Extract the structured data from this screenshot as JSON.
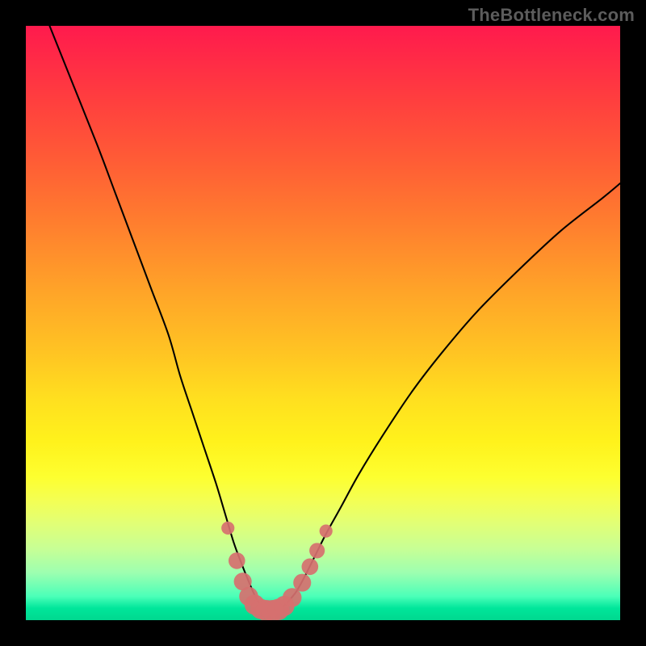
{
  "watermark": "TheBottleneck.com",
  "colors": {
    "frame": "#000000",
    "curve_stroke": "#000000",
    "marker_fill": "#d6706f",
    "gradient_top": "#ff1a4d",
    "gradient_bottom": "#00d88f"
  },
  "chart_data": {
    "type": "line",
    "title": "",
    "xlabel": "",
    "ylabel": "",
    "xlim": [
      0,
      100
    ],
    "ylim": [
      0,
      100
    ],
    "grid": false,
    "series": [
      {
        "name": "bottleneck-curve",
        "x": [
          4,
          8,
          12,
          15,
          18,
          21,
          24,
          26,
          28,
          30,
          32,
          33.5,
          35,
          36.3,
          37.5,
          38.5,
          39.3,
          40,
          41,
          42,
          43,
          44,
          45.5,
          47,
          48.5,
          50.5,
          53,
          56,
          60,
          65,
          70,
          76,
          83,
          90,
          97,
          100
        ],
        "y": [
          100,
          90,
          80,
          72,
          64,
          56,
          48,
          41,
          35,
          29,
          23,
          18,
          13,
          9.5,
          6.5,
          4.2,
          2.8,
          2.0,
          1.6,
          1.6,
          2.0,
          3.0,
          4.8,
          7.5,
          10.5,
          14.5,
          19,
          24.5,
          31,
          38.5,
          45,
          52,
          59,
          65.5,
          71,
          73.5
        ]
      }
    ],
    "markers": [
      {
        "x": 34.0,
        "y": 15.5,
        "r": 1.1
      },
      {
        "x": 35.5,
        "y": 10.0,
        "r": 1.4
      },
      {
        "x": 36.5,
        "y": 6.5,
        "r": 1.5
      },
      {
        "x": 37.5,
        "y": 4.0,
        "r": 1.6
      },
      {
        "x": 38.5,
        "y": 2.6,
        "r": 1.7
      },
      {
        "x": 39.5,
        "y": 1.9,
        "r": 1.7
      },
      {
        "x": 40.5,
        "y": 1.6,
        "r": 1.8
      },
      {
        "x": 41.5,
        "y": 1.6,
        "r": 1.8
      },
      {
        "x": 42.5,
        "y": 1.8,
        "r": 1.8
      },
      {
        "x": 43.5,
        "y": 2.4,
        "r": 1.7
      },
      {
        "x": 44.8,
        "y": 3.8,
        "r": 1.6
      },
      {
        "x": 46.5,
        "y": 6.3,
        "r": 1.5
      },
      {
        "x": 47.8,
        "y": 9.0,
        "r": 1.4
      },
      {
        "x": 49.0,
        "y": 11.7,
        "r": 1.3
      },
      {
        "x": 50.5,
        "y": 15.0,
        "r": 1.1
      }
    ]
  }
}
